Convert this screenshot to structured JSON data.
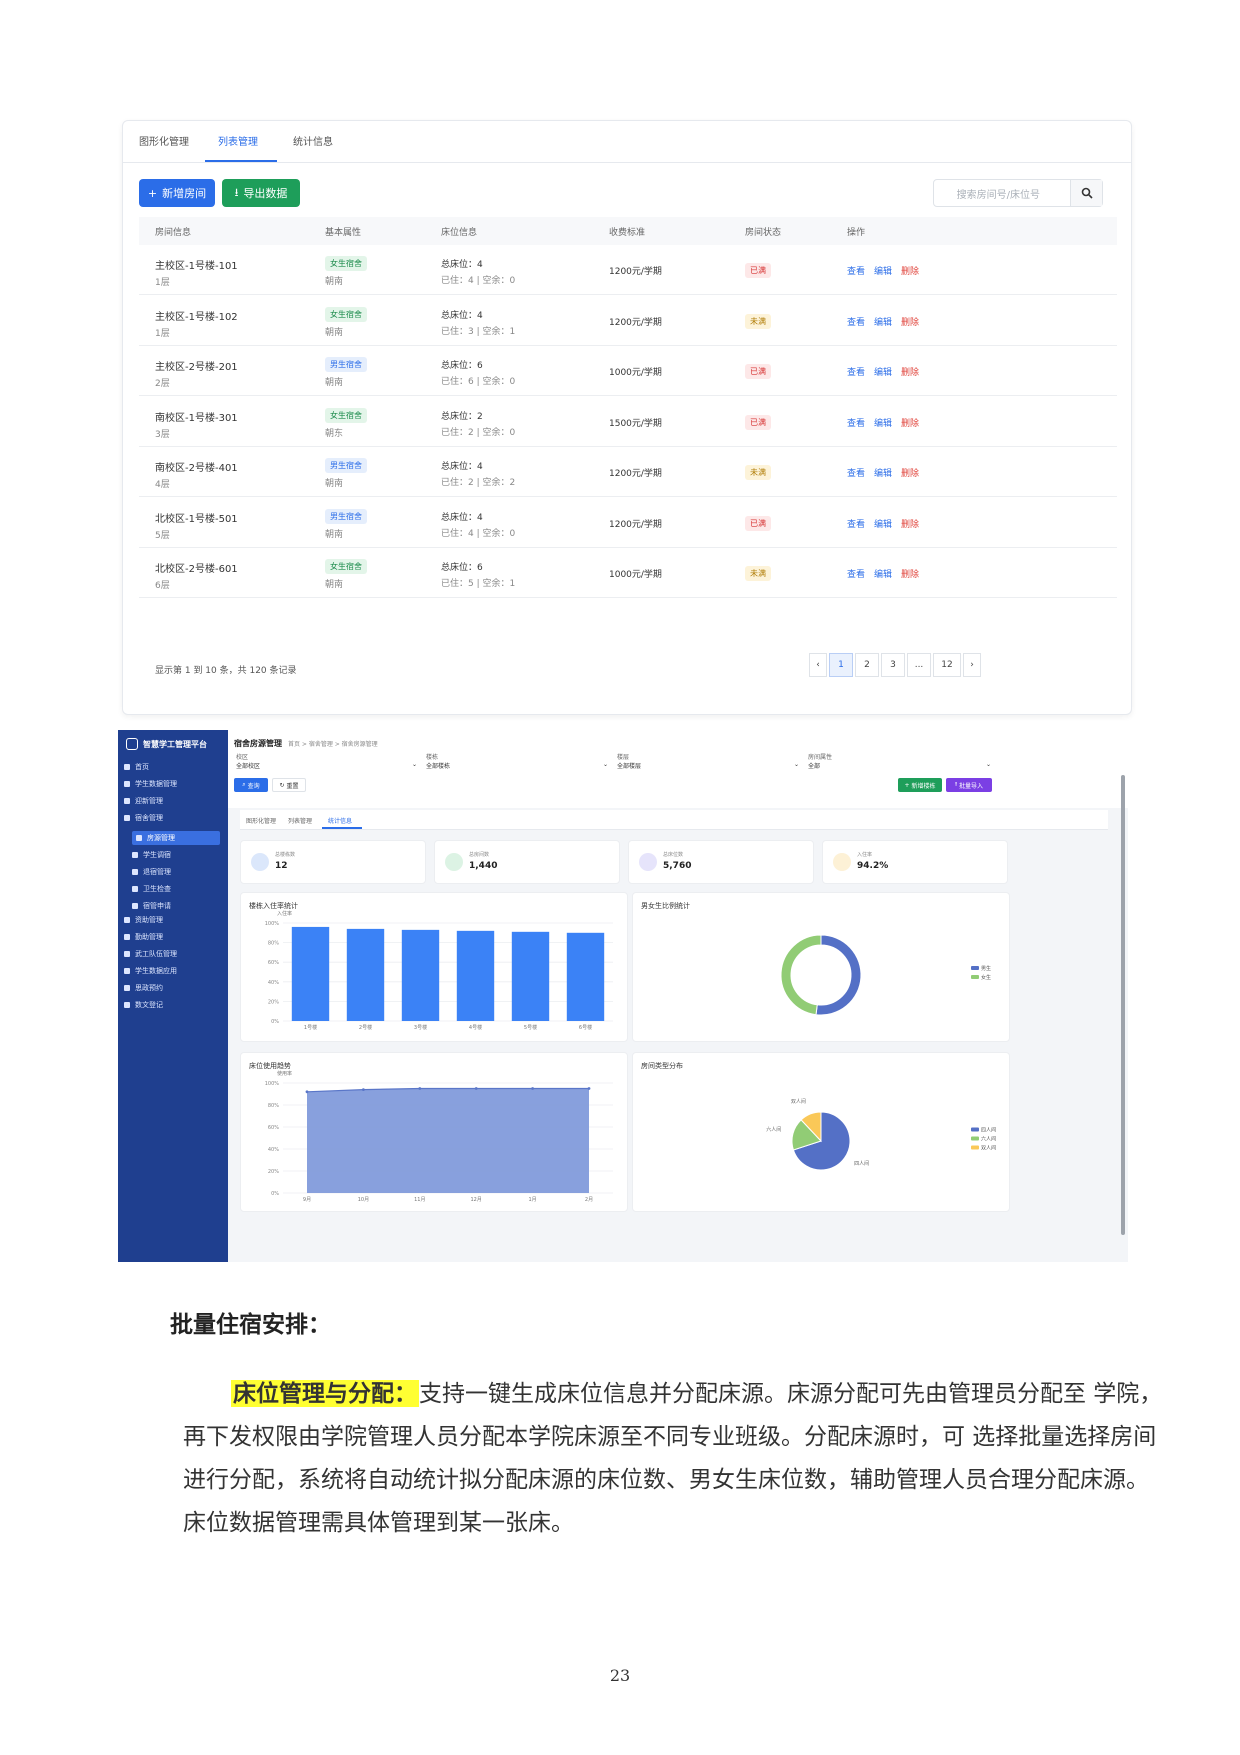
{
  "shot1": {
    "tabs": [
      "图形化管理",
      "列表管理",
      "统计信息"
    ],
    "add_btn": "新增房间",
    "export_btn": "导出数据",
    "search_placeholder": "搜索房间号/床位号",
    "headers": [
      "房间信息",
      "基本属性",
      "床位信息",
      "收费标准",
      "房间状态",
      "操作"
    ],
    "rows": [
      {
        "room": "主校区-1号楼-101",
        "floor": "1层",
        "type": "女生宿舍",
        "gender": "f",
        "orient": "朝南",
        "total": "总床位：4",
        "occ": "已住：4 | 空余：0",
        "fee": "1200元/学期",
        "status": "已满",
        "full": true
      },
      {
        "room": "主校区-1号楼-102",
        "floor": "1层",
        "type": "女生宿舍",
        "gender": "f",
        "orient": "朝南",
        "total": "总床位：4",
        "occ": "已住：3 | 空余：1",
        "fee": "1200元/学期",
        "status": "未满",
        "full": false
      },
      {
        "room": "主校区-2号楼-201",
        "floor": "2层",
        "type": "男生宿舍",
        "gender": "m",
        "orient": "朝南",
        "total": "总床位：6",
        "occ": "已住：6 | 空余：0",
        "fee": "1000元/学期",
        "status": "已满",
        "full": true
      },
      {
        "room": "南校区-1号楼-301",
        "floor": "3层",
        "type": "女生宿舍",
        "gender": "f",
        "orient": "朝东",
        "total": "总床位：2",
        "occ": "已住：2 | 空余：0",
        "fee": "1500元/学期",
        "status": "已满",
        "full": true
      },
      {
        "room": "南校区-2号楼-401",
        "floor": "4层",
        "type": "男生宿舍",
        "gender": "m",
        "orient": "朝南",
        "total": "总床位：4",
        "occ": "已住：2 | 空余：2",
        "fee": "1200元/学期",
        "status": "未满",
        "full": false
      },
      {
        "room": "北校区-1号楼-501",
        "floor": "5层",
        "type": "男生宿舍",
        "gender": "m",
        "orient": "朝南",
        "total": "总床位：4",
        "occ": "已住：4 | 空余：0",
        "fee": "1200元/学期",
        "status": "已满",
        "full": true
      },
      {
        "room": "北校区-2号楼-601",
        "floor": "6层",
        "type": "女生宿舍",
        "gender": "f",
        "orient": "朝南",
        "total": "总床位：6",
        "occ": "已住：5 | 空余：1",
        "fee": "1000元/学期",
        "status": "未满",
        "full": false
      }
    ],
    "actions": [
      "查看",
      "编辑",
      "删除"
    ],
    "footer": "显示第 1 到 10 条，共 120 条记录",
    "pages": [
      "‹",
      "1",
      "2",
      "3",
      "...",
      "12",
      "›"
    ]
  },
  "shot2": {
    "app_title": "智慧学工管理平台",
    "page_title": "宿舍房源管理",
    "breadcrumb": "首页 > 宿舍管理 > 宿舍房源管理",
    "nav": [
      "首页",
      "学生数据管理",
      "迎新管理",
      "宿舍管理"
    ],
    "subnav": [
      "房源管理",
      "学生调宿",
      "退宿管理",
      "卫生检查",
      "宿管申请"
    ],
    "nav2": [
      "资助管理",
      "勤助管理",
      "武工队伍管理",
      "学生数据应用",
      "思政预约",
      "数文登记"
    ],
    "filters": [
      {
        "label": "校区",
        "value": "全部校区"
      },
      {
        "label": "楼栋",
        "value": "全部楼栋"
      },
      {
        "label": "楼层",
        "value": "全部楼层"
      },
      {
        "label": "房间属性",
        "value": "全部"
      }
    ],
    "query_btn": "查询",
    "reset_btn": "重置",
    "add_btn": "新增楼栋",
    "import_btn": "批量导入",
    "tabs": [
      "图形化管理",
      "列表管理",
      "统计信息"
    ],
    "stats": [
      {
        "label": "总楼栋数",
        "value": "12",
        "color": "#dbe7fb"
      },
      {
        "label": "总房间数",
        "value": "1,440",
        "color": "#dcf3e4"
      },
      {
        "label": "总床位数",
        "value": "5,760",
        "color": "#e6e4fb"
      },
      {
        "label": "入住率",
        "value": "94.2%",
        "color": "#fdf1d6"
      }
    ],
    "bar_title": "楼栋入住率统计",
    "donut_title": "男女生比例统计",
    "area_title": "床位使用趋势",
    "pie_title": "房间类型分布"
  },
  "chart_data": [
    {
      "type": "bar",
      "title": "楼栋入住率统计",
      "ylabel": "入住率",
      "categories": [
        "1号楼",
        "2号楼",
        "3号楼",
        "4号楼",
        "5号楼",
        "6号楼"
      ],
      "values": [
        96,
        94,
        93,
        92,
        91,
        90
      ],
      "yticks": [
        "100%",
        "80%",
        "60%",
        "40%",
        "20%",
        "0%"
      ],
      "ylim": [
        0,
        100
      ],
      "color": "#3b82f6"
    },
    {
      "type": "pie",
      "title": "男女生比例统计",
      "categories": [
        "男生",
        "女生"
      ],
      "values": [
        52,
        48
      ],
      "colors": [
        "#5470c6",
        "#91cc75"
      ],
      "legend": "right"
    },
    {
      "type": "area",
      "title": "床位使用趋势",
      "ylabel": "使用率",
      "categories": [
        "9月",
        "10月",
        "11月",
        "12月",
        "1月",
        "2月"
      ],
      "values": [
        92,
        94,
        95,
        95,
        95,
        95
      ],
      "yticks": [
        "100%",
        "80%",
        "60%",
        "40%",
        "20%",
        "0%"
      ],
      "ylim": [
        0,
        100
      ],
      "color": "#7b96d9"
    },
    {
      "type": "pie",
      "title": "房间类型分布",
      "categories": [
        "四人间",
        "六人间",
        "双人间"
      ],
      "values": [
        70,
        18,
        12
      ],
      "colors": [
        "#5470c6",
        "#91cc75",
        "#fac858"
      ],
      "legend": "right"
    }
  ],
  "text": {
    "heading": "批量住宿安排：",
    "lead": "床位管理与分配：",
    "body": "支持一键生成床位信息并分配床源。床源分配可先由管理员分配至 学院，再下发权限由学院管理人员分配本学院床源至不同专业班级。分配床源时，可 选择批量选择房间进行分配，系统将自动统计拟分配床源的床位数、男女生床位数，辅助管理人员合理分配床源。床位数据管理需具体管理到某一张床。",
    "page_number": "23"
  }
}
